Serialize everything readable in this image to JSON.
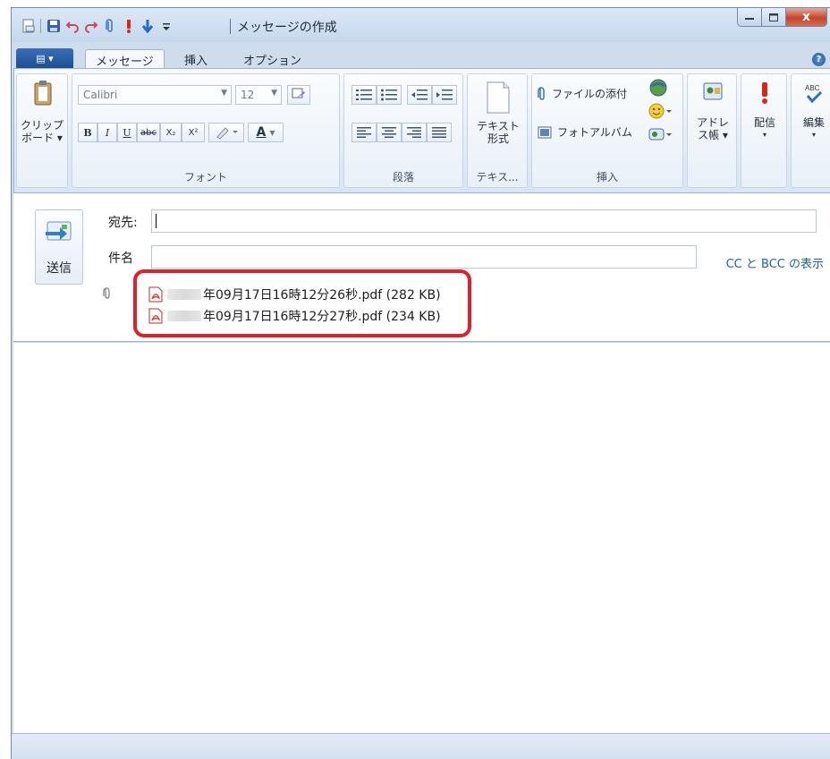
{
  "window": {
    "title": "メッセージの作成",
    "buttons": {
      "minimize": "–",
      "maximize": "□",
      "close": "x"
    }
  },
  "quick_access": {
    "icons": [
      "new-message-icon",
      "save-icon",
      "undo-icon",
      "redo-icon",
      "attach-icon",
      "high-priority-icon",
      "low-priority-icon",
      "customize-icon"
    ]
  },
  "tabs": {
    "app_menu": "▤ ▾",
    "items": [
      {
        "label": "メッセージ",
        "active": true
      },
      {
        "label": "挿入",
        "active": false
      },
      {
        "label": "オプション",
        "active": false
      }
    ],
    "help": "?"
  },
  "ribbon": {
    "clipboard": {
      "label_line1": "クリップ",
      "label_line2": "ボード ▾"
    },
    "font": {
      "family": "Calibri",
      "size": "12",
      "group_label": "フォント",
      "bold": "B",
      "italic": "I",
      "underline": "U",
      "strike": "abc",
      "subscript": "X₂",
      "superscript": "X²",
      "color": "A"
    },
    "paragraph": {
      "group_label": "段落"
    },
    "text_format": {
      "label_line1": "テキスト",
      "label_line2": "形式",
      "group_label": "テキス..."
    },
    "insert": {
      "attach_file": "ファイルの添付",
      "photo_album": "フォトアルバム",
      "group_label": "挿入"
    },
    "address_book": {
      "label_line1": "アドレ",
      "label_line2": "ス帳 ▾"
    },
    "deliver": {
      "label": "配信",
      "arrow": "▾"
    },
    "edit": {
      "label": "編集",
      "arrow": "▾"
    }
  },
  "compose": {
    "send_label": "送信",
    "to_label": "宛先:",
    "to_value": "",
    "subject_label": "件名",
    "subject_value": "",
    "cc_bcc_link": "CC と BCC の表示",
    "attachments": [
      {
        "name": "年09月17日16時12分26秒.pdf (282 KB)"
      },
      {
        "name": "年09月17日16時12分27秒.pdf (234 KB)"
      }
    ]
  },
  "colors": {
    "highlight_border": "#e0202a",
    "link": "#1f5fb3",
    "close_button": "#c7462d"
  }
}
